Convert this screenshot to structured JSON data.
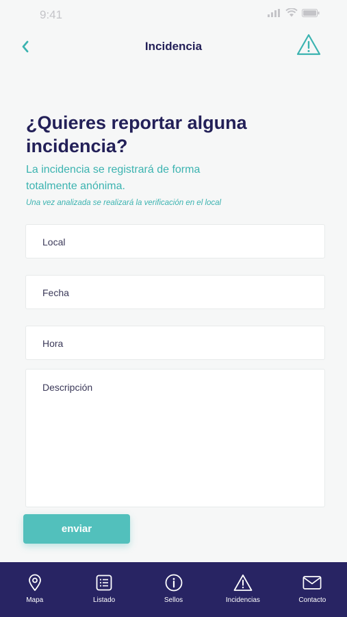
{
  "status": {
    "time": "9:41"
  },
  "nav": {
    "title": "Incidencia"
  },
  "page": {
    "heading": "¿Quieres reportar alguna incidencia?",
    "subtitle": "La incidencia se registrará de forma totalmente anónima.",
    "note": "Una vez analizada se realizará la verificación en el local"
  },
  "form": {
    "local_placeholder": "Local",
    "fecha_placeholder": "Fecha",
    "hora_placeholder": "Hora",
    "descripcion_placeholder": "Descripción",
    "send_label": "enviar"
  },
  "tabs": [
    {
      "label": "Mapa",
      "icon": "map-pin-icon"
    },
    {
      "label": "Listado",
      "icon": "list-icon"
    },
    {
      "label": "Sellos",
      "icon": "info-icon"
    },
    {
      "label": "Incidencias",
      "icon": "warning-icon"
    },
    {
      "label": "Contacto",
      "icon": "mail-icon"
    }
  ],
  "colors": {
    "primary": "#232058",
    "accent": "#3bb3b0",
    "button": "#52c0bc",
    "tab_bar": "#282463",
    "background": "#f6f7f7"
  }
}
